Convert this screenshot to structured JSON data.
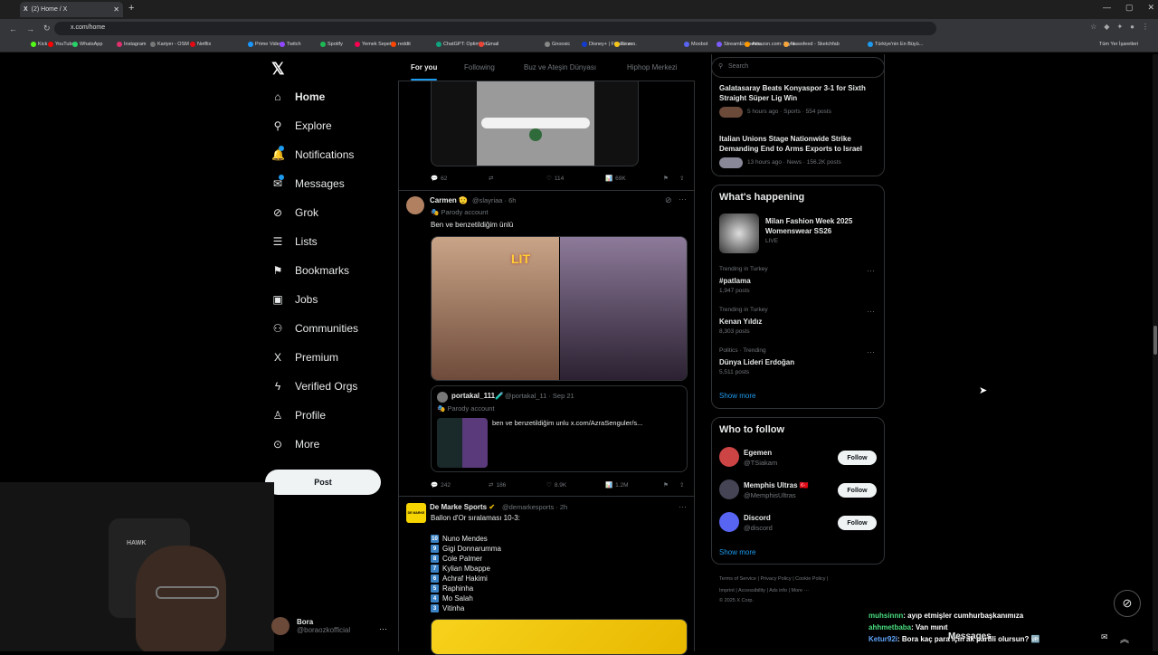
{
  "browser": {
    "tab_title": "(2) Home / X",
    "url": "x.com/home",
    "bookmarks": [
      "Kick",
      "YouTube",
      "WhatsApp",
      "Instagram",
      "Kariyer - OSM",
      "Netflix",
      "Prime Video",
      "Twitch",
      "Spotify",
      "Yemek Sepeti",
      "reddit",
      "ChatGPT: Optimizin...",
      "Gmail",
      "Gnoosic",
      "Disney+ | Filmler ve...",
      "Exxen",
      "Moobot",
      "StreamElements",
      "Amazon.com: Stylo...",
      "Newsfeed - Sketchfab",
      "Türkiye'nin En Büyü..."
    ],
    "all_bookmarks": "Tüm Yer İşaretleri"
  },
  "nav": {
    "items": [
      {
        "label": "Home",
        "icon": "home-icon",
        "glyph": "⌂"
      },
      {
        "label": "Explore",
        "icon": "search-icon",
        "glyph": "⚲"
      },
      {
        "label": "Notifications",
        "icon": "bell-icon",
        "glyph": "🔔"
      },
      {
        "label": "Messages",
        "icon": "envelope-icon",
        "glyph": "✉"
      },
      {
        "label": "Grok",
        "icon": "grok-icon",
        "glyph": "⊘"
      },
      {
        "label": "Lists",
        "icon": "list-icon",
        "glyph": "☰"
      },
      {
        "label": "Bookmarks",
        "icon": "bookmark-icon",
        "glyph": "⚑"
      },
      {
        "label": "Jobs",
        "icon": "briefcase-icon",
        "glyph": "▣"
      },
      {
        "label": "Communities",
        "icon": "people-icon",
        "glyph": "⚇"
      },
      {
        "label": "Premium",
        "icon": "x-icon",
        "glyph": "X"
      },
      {
        "label": "Verified Orgs",
        "icon": "lightning-icon",
        "glyph": "ϟ"
      },
      {
        "label": "Profile",
        "icon": "person-icon",
        "glyph": "♙"
      },
      {
        "label": "More",
        "icon": "more-circle-icon",
        "glyph": "⊙"
      }
    ],
    "post_label": "Post",
    "user_name": "Bora",
    "user_handle": "@boraozkofficial"
  },
  "webcam_text": "HAWK",
  "timeline": {
    "tabs": [
      "For you",
      "Following",
      "Buz ve Ateşin Dünyası",
      "Hiphop Merkezi"
    ],
    "tweet1": {
      "replies": "62",
      "retweets": "",
      "likes": "114",
      "views": "69K"
    },
    "tweet2": {
      "name": "Carmen 🫡",
      "handle": "@slayriaa · 6h",
      "parody": "Parody account",
      "text": "Ben ve benzetildiğim ünlü",
      "sticker": "LIT",
      "quote_name": "portakal_111🧪",
      "quote_handle": "@portakal_11 · Sep 21",
      "quote_parody": "Parody account",
      "quote_text": "ben ve benzetildiğim unlu  x.com/AzraSenguler/s...",
      "replies": "242",
      "retweets": "186",
      "likes": "8.9K",
      "views": "1.2M"
    },
    "tweet3": {
      "avatar_text": "DE MARKE",
      "name": "De Marke Sports",
      "handle": "@demarkesports · 2h",
      "text": "Ballon d'Or sıralaması 10-3:",
      "ranks": [
        {
          "num": "10",
          "name": "Nuno Mendes"
        },
        {
          "num": "9",
          "name": "Gigi Donnarumma"
        },
        {
          "num": "8",
          "name": "Cole Palmer"
        },
        {
          "num": "7",
          "name": "Kylian Mbappe"
        },
        {
          "num": "6",
          "name": "Achraf Hakimi"
        },
        {
          "num": "5",
          "name": "Raphinha"
        },
        {
          "num": "4",
          "name": "Mo Salah"
        },
        {
          "num": "3",
          "name": "Vitinha"
        }
      ]
    }
  },
  "sidebar": {
    "search_placeholder": "Search",
    "news": [
      {
        "title": "Galatasaray Beats Konyaspor 3-1 for Sixth Straight Süper Lig Win",
        "meta": "5 hours ago · Sports · 554 posts"
      },
      {
        "title": "Italian Unions Stage Nationwide Strike Demanding End to Arms Exports to Israel",
        "meta": "13 hours ago · News · 156.2K posts"
      }
    ],
    "whats_happening": "What's happening",
    "event": {
      "title": "Milan Fashion Week 2025 Womenswear SS26",
      "meta": "LIVE"
    },
    "trends": [
      {
        "context": "Trending in Turkey",
        "name": "#patlama",
        "posts": "1,947 posts"
      },
      {
        "context": "Trending in Turkey",
        "name": "Kenan Yıldız",
        "posts": "8,303 posts"
      },
      {
        "context": "Politics · Trending",
        "name": "Dünya Lideri Erdoğan",
        "posts": "5,511 posts"
      }
    ],
    "show_more": "Show more",
    "who_to_follow": "Who to follow",
    "follow": [
      {
        "name": "Egemen",
        "handle": "@TSiakam",
        "btn": "Follow"
      },
      {
        "name": "Memphis Ultras 🇹🇷",
        "handle": "@MemphisUltras",
        "btn": "Follow"
      },
      {
        "name": "Discord",
        "handle": "@discord",
        "btn": "Follow"
      }
    ],
    "footer1": "Terms of Service  |  Privacy Policy  |  Cookie Policy  |",
    "footer2": "Imprint  |  Accessibility  |  Ads info  |  More ···",
    "footer3": "© 2025 X Corp."
  },
  "chat": [
    {
      "user": "muhsinnn",
      "msg": ": ayıp etmişler cumhurbaşkanımıza",
      "color": "#4ade80"
    },
    {
      "user": "ahhmetbaba",
      "msg": ": Van mınıt",
      "color": "#4ade80"
    },
    {
      "user": "Ketur92i",
      "msg": ": Bora kaç para için ak partili olursun? 🆙",
      "color": "#60a5fa"
    }
  ],
  "messages_bar": "Messages"
}
